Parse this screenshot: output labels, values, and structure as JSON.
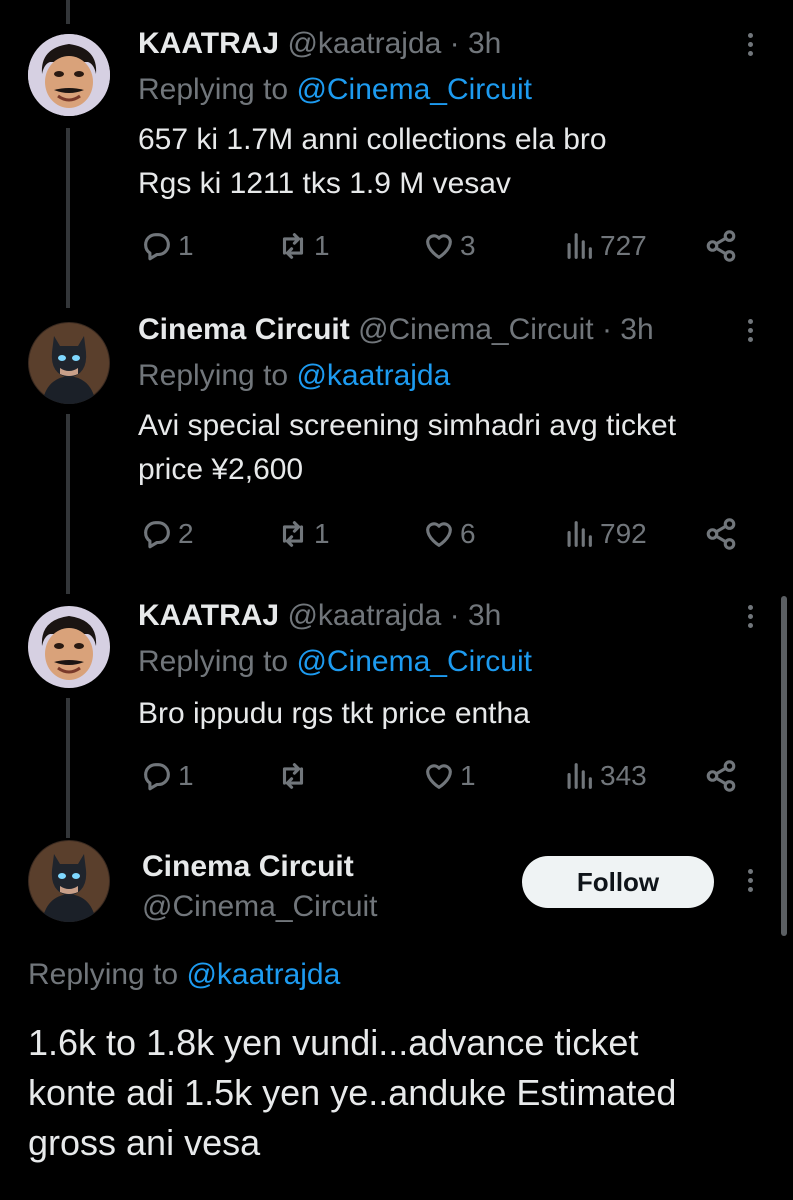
{
  "tweets": [
    {
      "name": "KAATRAJ",
      "handle": "@kaatrajda",
      "time": "· 3h",
      "replying_prefix": "Replying to",
      "replying_to": "@Cinema_Circuit",
      "body_lines": [
        "657 ki 1.7M anni collections ela bro",
        "Rgs ki 1211 tks 1.9 M vesav"
      ],
      "replies": "1",
      "retweets": "1",
      "likes": "3",
      "views": "727",
      "avatar": "caricature-face"
    },
    {
      "name": "Cinema Circuit",
      "handle": "@Cinema_Circuit",
      "time": "· 3h",
      "replying_prefix": "Replying to",
      "replying_to": "@kaatrajda",
      "body_lines": [
        "Avi special screening simhadri avg ticket",
        "price ¥2,600"
      ],
      "replies": "2",
      "retweets": "1",
      "likes": "6",
      "views": "792",
      "avatar": "batman-figure"
    },
    {
      "name": "KAATRAJ",
      "handle": "@kaatrajda",
      "time": "· 3h",
      "replying_prefix": "Replying to",
      "replying_to": "@Cinema_Circuit",
      "body_lines": [
        "Bro ippudu rgs tkt price entha"
      ],
      "replies": "1",
      "retweets": "",
      "likes": "1",
      "views": "343",
      "avatar": "caricature-face"
    }
  ],
  "main_tweet": {
    "name": "Cinema Circuit",
    "handle": "@Cinema_Circuit",
    "follow_label": "Follow",
    "replying_prefix": "Replying to",
    "replying_to": "@kaatrajda",
    "body_lines": [
      "1.6k to 1.8k yen vundi...advance ticket",
      "konte adi 1.5k yen ye..anduke Estimated",
      "gross ani vesa"
    ],
    "avatar": "batman-figure"
  },
  "colors": {
    "background": "#000000",
    "text": "#e7e9ea",
    "muted": "#71767b",
    "link": "#1d9bf0",
    "follow_bg": "#eff3f4"
  },
  "icons": [
    "reply-icon",
    "retweet-icon",
    "like-icon",
    "views-icon",
    "share-icon",
    "more-icon"
  ]
}
